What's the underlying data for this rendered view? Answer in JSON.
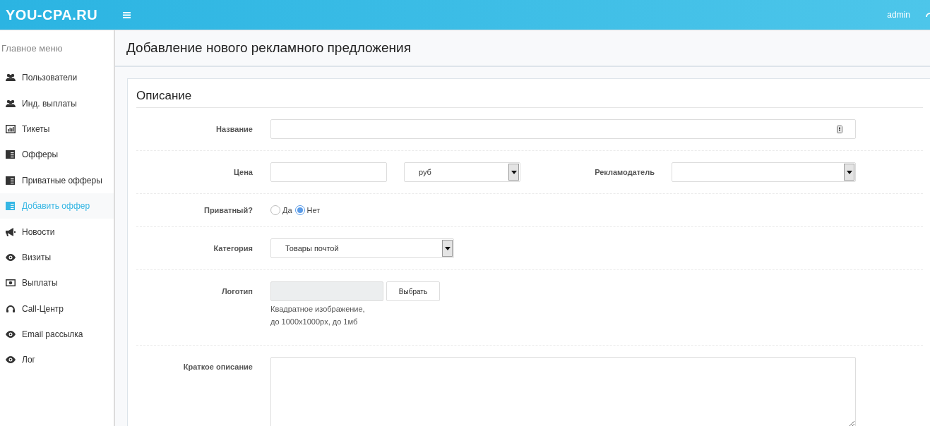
{
  "header": {
    "brand": "YOU-CPA.RU",
    "user": "admin"
  },
  "sidebar": {
    "heading": "Главное меню",
    "items": [
      {
        "label": "Пользователи",
        "kind": "users",
        "selected": false
      },
      {
        "label": "Инд. выплаты",
        "kind": "users",
        "selected": false
      },
      {
        "label": "Тикеты",
        "kind": "chart",
        "selected": false
      },
      {
        "label": "Офферы",
        "kind": "list",
        "selected": false
      },
      {
        "label": "Приватные офферы",
        "kind": "list",
        "selected": false
      },
      {
        "label": "Добавить оффер",
        "kind": "list",
        "selected": true
      },
      {
        "label": "Новости",
        "kind": "bullhorn",
        "selected": false
      },
      {
        "label": "Визиты",
        "kind": "eye",
        "selected": false
      },
      {
        "label": "Выплаты",
        "kind": "money",
        "selected": false
      },
      {
        "label": "Call-Центр",
        "kind": "headset",
        "selected": false
      },
      {
        "label": "Email рассылка",
        "kind": "eye",
        "selected": false
      },
      {
        "label": "Лог",
        "kind": "eye",
        "selected": false
      }
    ]
  },
  "page_title": "Добавление нового рекламного предложения",
  "section_title": "Описание",
  "form": {
    "name": {
      "label": "Название"
    },
    "price": {
      "label": "Цена",
      "currency": "руб"
    },
    "advertiser": {
      "label": "Рекламодатель"
    },
    "private": {
      "label": "Приватный?",
      "options": [
        {
          "label": "Да",
          "selected": false
        },
        {
          "label": "Нет",
          "selected": true
        }
      ]
    },
    "category": {
      "label": "Категория",
      "value": "Товары почтой"
    },
    "logo": {
      "label": "Логотип",
      "button": "Выбрать",
      "hint_lines": [
        "Квадратное изображение,",
        "до 1000x1000px, до 1мб"
      ]
    },
    "description": {
      "label": "Краткое описание"
    }
  }
}
